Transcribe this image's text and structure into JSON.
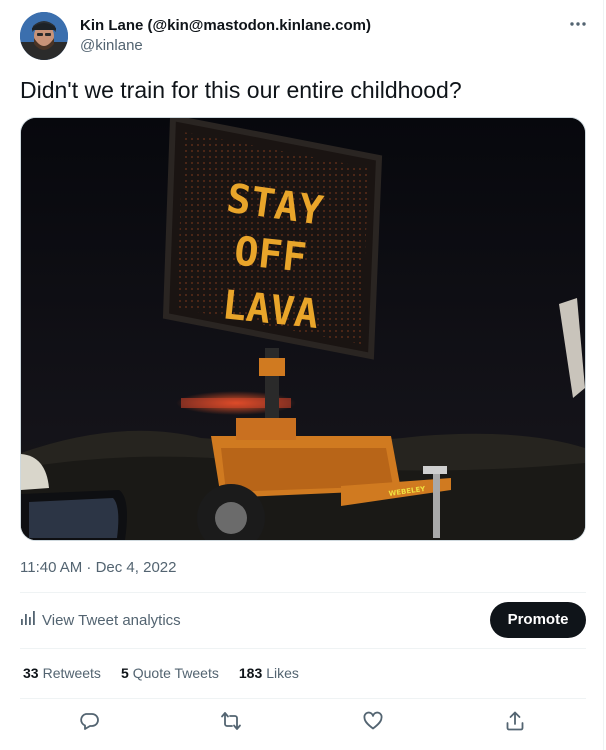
{
  "tweet": {
    "author": {
      "display_name": "Kin Lane (@kin@mastodon.kinlane.com)",
      "handle": "@kinlane"
    },
    "more_icon": "more-horizontal-icon",
    "text": "Didn't we train for this our entire childhood?",
    "media": {
      "sign_lines": [
        "STAY",
        "OFF",
        "LAVA"
      ],
      "trailer_label": "WEBELEY"
    },
    "timestamp": "11:40 AM · Dec 4, 2022",
    "analytics_label": "View Tweet analytics",
    "promote_label": "Promote",
    "stats": [
      {
        "count": "33",
        "label": "Retweets"
      },
      {
        "count": "5",
        "label": "Quote Tweets"
      },
      {
        "count": "183",
        "label": "Likes"
      }
    ],
    "actions": [
      "reply-icon",
      "retweet-icon",
      "like-icon",
      "share-icon"
    ]
  },
  "colors": {
    "text_primary": "#0f1419",
    "text_secondary": "#536471",
    "divider": "#eff3f4",
    "promote_bg": "#0f1419",
    "sign_led": "#e9a52a"
  }
}
